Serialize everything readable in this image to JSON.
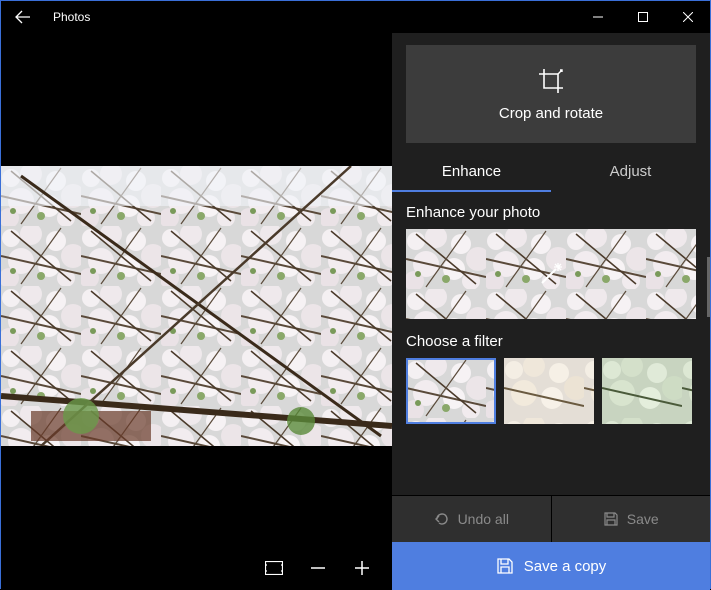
{
  "titlebar": {
    "title": "Photos"
  },
  "cropRotate": {
    "label": "Crop and rotate"
  },
  "tabs": {
    "enhance": "Enhance",
    "adjust": "Adjust",
    "active": "enhance"
  },
  "enhance": {
    "title": "Enhance your photo"
  },
  "filters": {
    "title": "Choose a filter",
    "items": [
      {
        "id": "original",
        "selected": true
      },
      {
        "id": "filter-2",
        "selected": false
      },
      {
        "id": "filter-3",
        "selected": false
      }
    ]
  },
  "actions": {
    "undo": "Undo all",
    "save": "Save",
    "saveCopy": "Save a copy"
  },
  "colors": {
    "accent": "#4f7ee0"
  }
}
